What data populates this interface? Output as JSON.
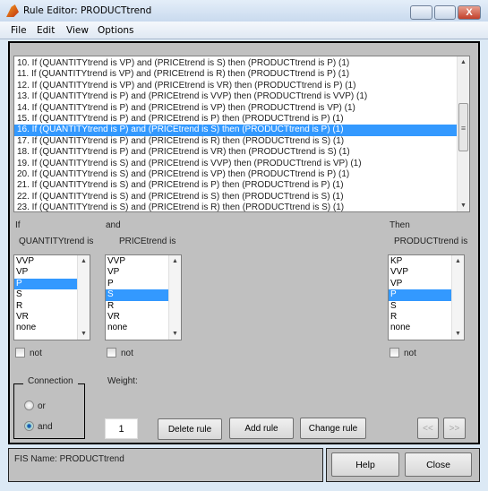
{
  "window": {
    "title": "Rule Editor: PRODUCTtrend",
    "close_glyph": "X"
  },
  "menu": [
    "File",
    "Edit",
    "View",
    "Options"
  ],
  "rules": {
    "selected_index": 6,
    "items": [
      "10. If (QUANTITYtrend is VP) and (PRICEtrend is S) then (PRODUCTtrend is P) (1)",
      "11. If (QUANTITYtrend is VP) and (PRICEtrend is R) then (PRODUCTtrend is P) (1)",
      "12. If (QUANTITYtrend is VP) and (PRICEtrend is VR) then (PRODUCTtrend is P) (1)",
      "13. If (QUANTITYtrend is P) and (PRICEtrend is VVP) then (PRODUCTtrend is VVP) (1)",
      "14. If (QUANTITYtrend is P) and (PRICEtrend is VP) then (PRODUCTtrend is VP) (1)",
      "15. If (QUANTITYtrend is P) and (PRICEtrend is P) then (PRODUCTtrend is P) (1)",
      "16. If (QUANTITYtrend is P) and (PRICEtrend is S) then (PRODUCTtrend is P) (1)",
      "17. If (QUANTITYtrend is P) and (PRICEtrend is R) then (PRODUCTtrend is S) (1)",
      "18. If (QUANTITYtrend is P) and (PRICEtrend is VR) then (PRODUCTtrend is S) (1)",
      "19. If (QUANTITYtrend is S) and (PRICEtrend is VVP) then (PRODUCTtrend is VP) (1)",
      "20. If (QUANTITYtrend is S) and (PRICEtrend is VP) then (PRODUCTtrend is P) (1)",
      "21. If (QUANTITYtrend is S) and (PRICEtrend is P) then (PRODUCTtrend is P) (1)",
      "22. If (QUANTITYtrend is S) and (PRICEtrend is S) then (PRODUCTtrend is S) (1)",
      "23. If (QUANTITYtrend is S) and (PRICEtrend is R) then (PRODUCTtrend is S) (1)"
    ]
  },
  "if": {
    "label": "If",
    "var": "QUANTITYtrend is",
    "options": [
      "VVP",
      "VP",
      "P",
      "S",
      "R",
      "VR",
      "none"
    ],
    "selected": 2,
    "not": "not"
  },
  "and": {
    "label": "and",
    "var": "PRICEtrend is",
    "options": [
      "VVP",
      "VP",
      "P",
      "S",
      "R",
      "VR",
      "none"
    ],
    "selected": 3,
    "not": "not"
  },
  "then": {
    "label": "Then",
    "var": "PRODUCTtrend is",
    "options": [
      "KP",
      "VVP",
      "VP",
      "P",
      "S",
      "R",
      "none"
    ],
    "selected": 3,
    "not": "not"
  },
  "connection": {
    "label": "Connection",
    "or": "or",
    "and": "and",
    "selected": "and"
  },
  "weight": {
    "label": "Weight:",
    "value": "1"
  },
  "buttons": {
    "delete": "Delete rule",
    "add": "Add rule",
    "change": "Change rule",
    "prev": "<<",
    "next": ">>",
    "help": "Help",
    "close": "Close"
  },
  "status": {
    "fis_name": "FIS Name: PRODUCTtrend"
  },
  "colors": {
    "selection": "#3399ff",
    "panel": "#c0c0c0"
  }
}
